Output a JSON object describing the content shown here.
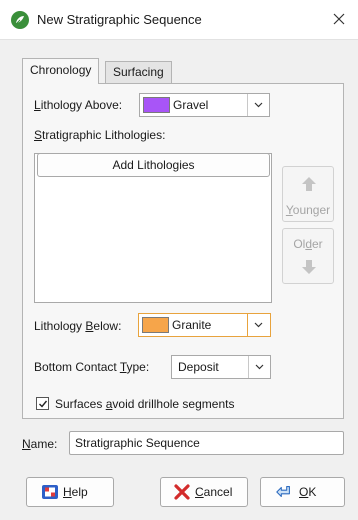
{
  "window": {
    "title": "New Stratigraphic Sequence",
    "icon": "leapfrog-app-icon",
    "close_icon": "close-icon"
  },
  "tabs": [
    {
      "label": "Chronology",
      "active": true
    },
    {
      "label": "Surfacing",
      "active": false
    }
  ],
  "chronology": {
    "lithology_above": {
      "label_accel": "L",
      "label_rest": "ithology Above:",
      "value": "Gravel",
      "swatch_color": "#a855f7"
    },
    "stratigraphic_lithologies": {
      "label_accel": "S",
      "label_rest": "tratigraphic Lithologies:",
      "add_button": "Add Lithologies",
      "items": []
    },
    "younger_button": {
      "label_accel": "Y",
      "label_rest": "ounger",
      "icon": "arrow-up-icon",
      "enabled": false
    },
    "older_button": {
      "label_pre": "Ol",
      "label_accel": "d",
      "label_rest": "er",
      "icon": "arrow-down-icon",
      "enabled": false
    },
    "lithology_below": {
      "label_pre": "Lithology ",
      "label_accel": "B",
      "label_rest": "elow:",
      "value": "Granite",
      "swatch_color": "#f6a54a"
    },
    "bottom_contact_type": {
      "label_pre": "Bottom Contact ",
      "label_accel": "T",
      "label_rest": "ype:",
      "value": "Deposit"
    },
    "avoid_drillhole": {
      "label_pre": "Surfaces ",
      "label_accel": "a",
      "label_rest": "void drillhole segments",
      "checked": true
    }
  },
  "name_field": {
    "label_accel": "N",
    "label_rest": "ame:",
    "value": "Stratigraphic Sequence"
  },
  "footer": {
    "help": {
      "label_accel": "H",
      "label_rest": "elp",
      "icon": "help-lifebuoy-icon"
    },
    "cancel": {
      "label_accel": "C",
      "label_rest": "ancel",
      "icon": "cancel-x-icon"
    },
    "ok": {
      "label_accel": "O",
      "label_rest": "K",
      "icon": "ok-arrow-icon"
    }
  },
  "colors": {
    "focus_accent": "#e8a33d",
    "app_icon_green": "#3a8f3a"
  }
}
